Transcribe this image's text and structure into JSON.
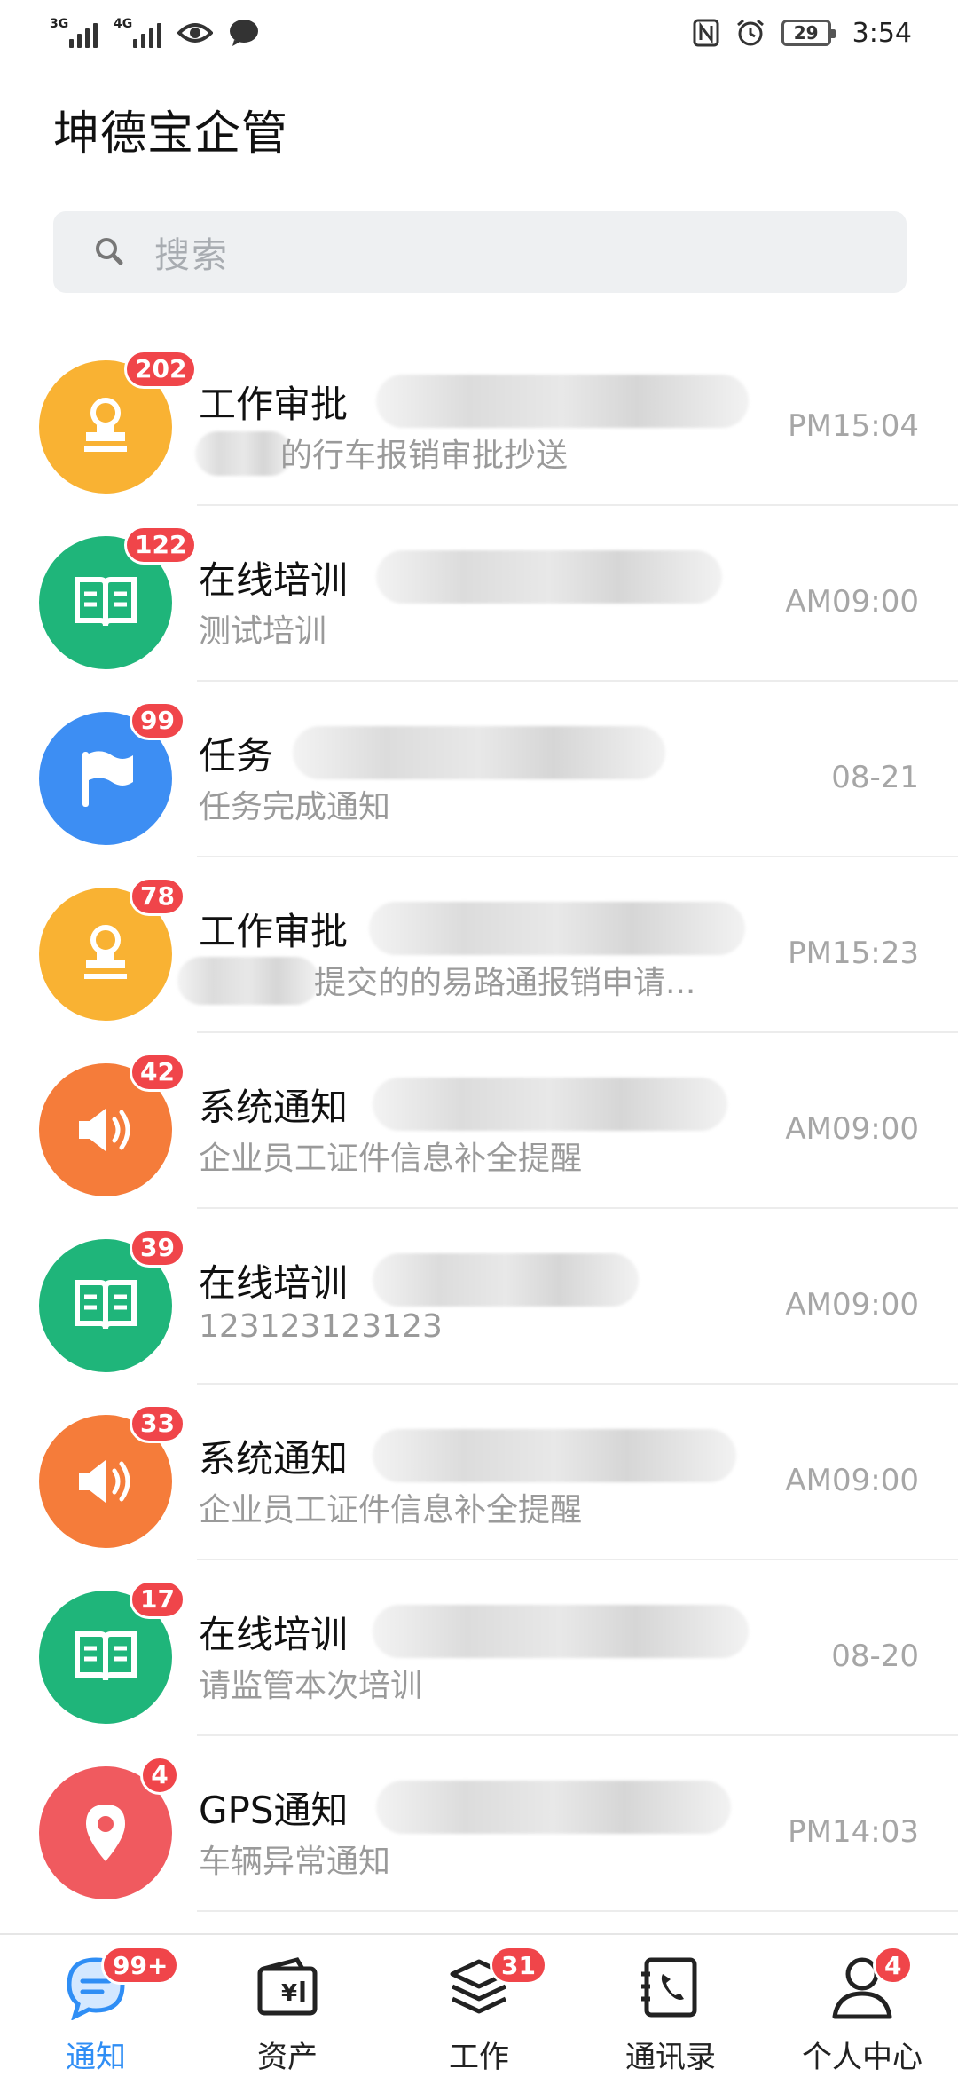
{
  "status_bar": {
    "signal1": "3G",
    "signal2": "4G",
    "battery": "29",
    "time": "3:54"
  },
  "app": {
    "title": "坤德宝企管"
  },
  "search": {
    "placeholder": "搜索"
  },
  "notifications": [
    {
      "title": "工作审批",
      "subtitle": "的行车报销审批抄送",
      "time": "PM15:04",
      "badge": "202",
      "icon": "stamp-icon",
      "color": "#f9b233"
    },
    {
      "title": "在线培训",
      "subtitle": "测试培训",
      "time": "AM09:00",
      "badge": "122",
      "icon": "book-icon",
      "color": "#1fb57a"
    },
    {
      "title": "任务",
      "subtitle": "任务完成通知",
      "time": "08-21",
      "badge": "99",
      "icon": "flag-icon",
      "color": "#3d8ef3"
    },
    {
      "title": "工作审批",
      "subtitle": "提交的的易路通报销申请...",
      "time": "PM15:23",
      "badge": "78",
      "icon": "stamp-icon",
      "color": "#f9b233"
    },
    {
      "title": "系统通知",
      "subtitle": "企业员工证件信息补全提醒",
      "time": "AM09:00",
      "badge": "42",
      "icon": "speaker-icon",
      "color": "#f57c3a"
    },
    {
      "title": "在线培训",
      "subtitle": "123123123123",
      "time": "AM09:00",
      "badge": "39",
      "icon": "book-icon",
      "color": "#1fb57a"
    },
    {
      "title": "系统通知",
      "subtitle": "企业员工证件信息补全提醒",
      "time": "AM09:00",
      "badge": "33",
      "icon": "speaker-icon",
      "color": "#f57c3a"
    },
    {
      "title": "在线培训",
      "subtitle": "请监管本次培训",
      "time": "08-20",
      "badge": "17",
      "icon": "book-icon",
      "color": "#1fb57a"
    },
    {
      "title": "GPS通知",
      "subtitle": "车辆异常通知",
      "time": "PM14:03",
      "badge": "4",
      "icon": "location-pin-icon",
      "color": "#f05a5f"
    }
  ],
  "bottom_nav": [
    {
      "label": "通知",
      "badge": "99+",
      "icon": "chat-bubble-icon",
      "active": true
    },
    {
      "label": "资产",
      "badge": "",
      "icon": "wallet-icon",
      "active": false
    },
    {
      "label": "工作",
      "badge": "31",
      "icon": "layers-icon",
      "active": false
    },
    {
      "label": "通讯录",
      "badge": "",
      "icon": "contacts-book-icon",
      "active": false
    },
    {
      "label": "个人中心",
      "badge": "4",
      "icon": "person-icon",
      "active": false
    }
  ],
  "colors": {
    "accent": "#2f8ef5",
    "badge": "#f0454a"
  }
}
